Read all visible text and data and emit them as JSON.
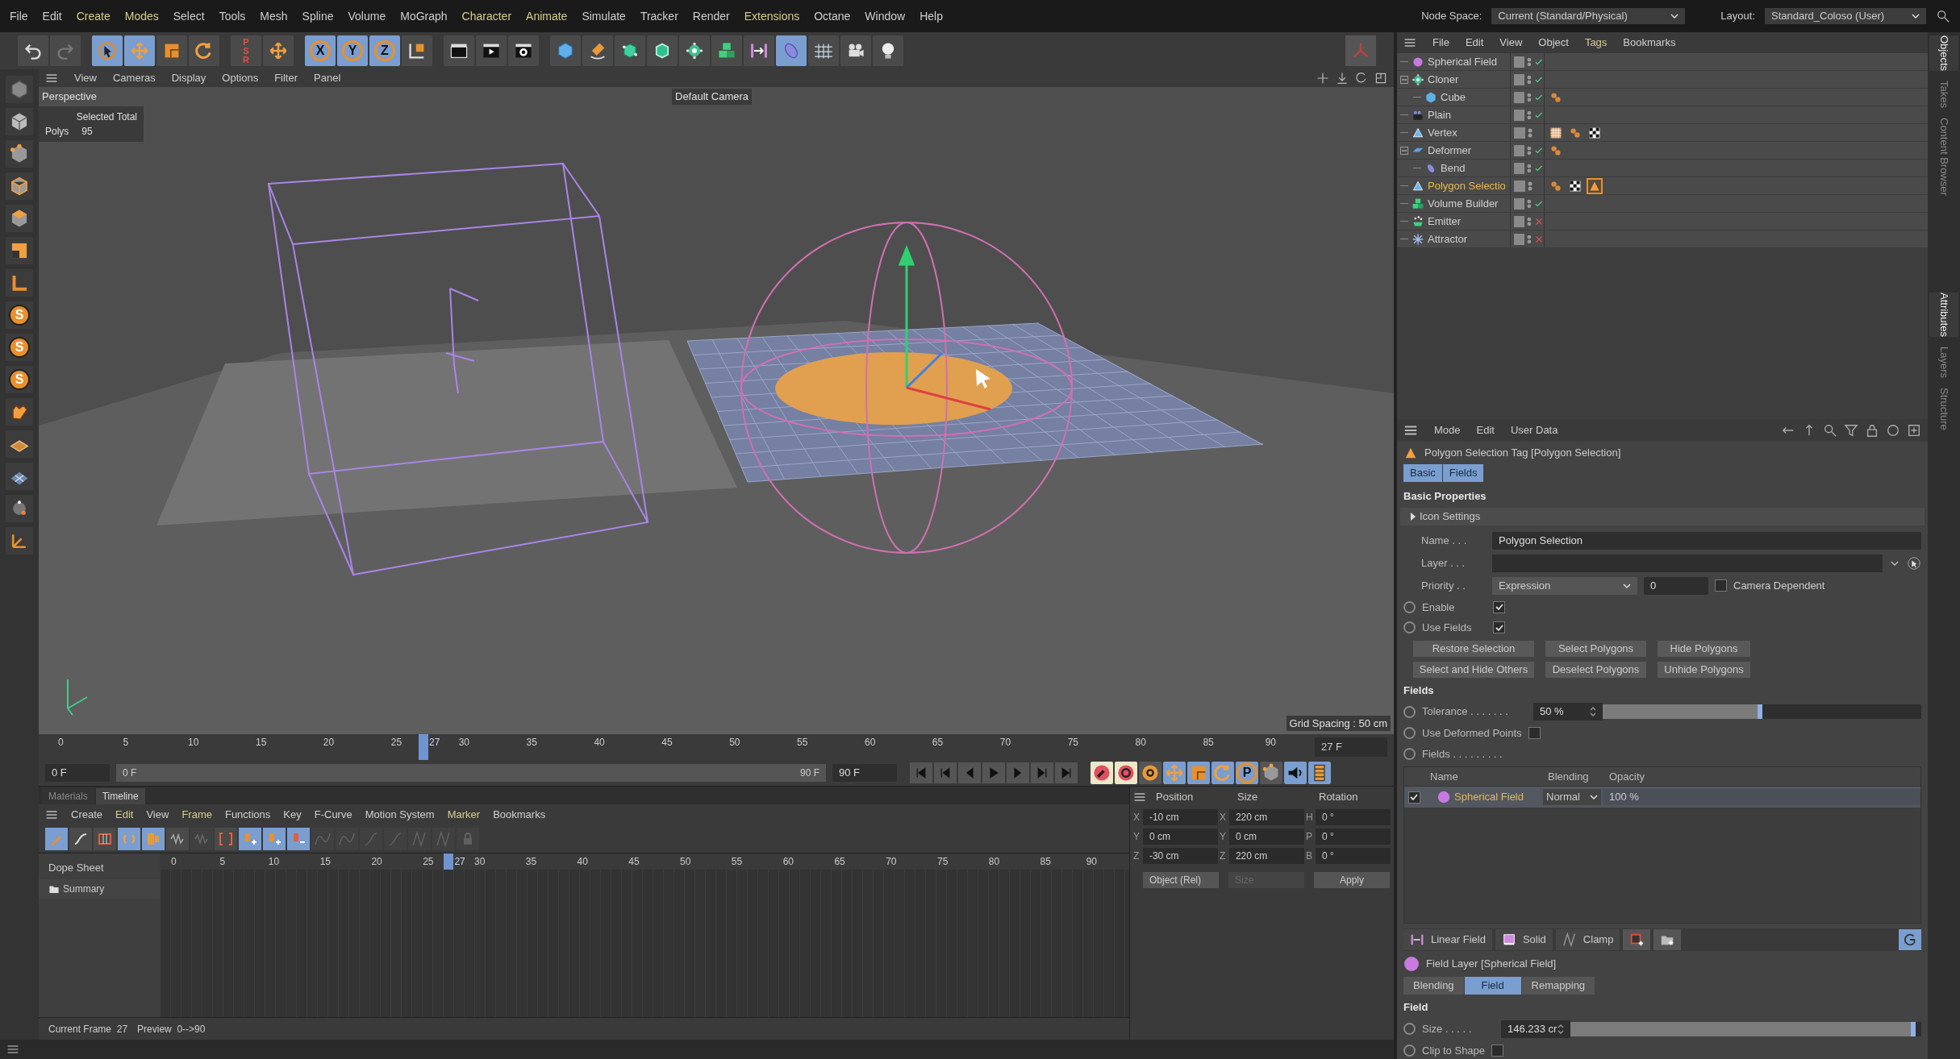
{
  "menu": [
    {
      "label": "File",
      "highlighted": false
    },
    {
      "label": "Edit",
      "highlighted": false
    },
    {
      "label": "Create",
      "highlighted": true
    },
    {
      "label": "Modes",
      "highlighted": true
    },
    {
      "label": "Select",
      "highlighted": false
    },
    {
      "label": "Tools",
      "highlighted": false
    },
    {
      "label": "Mesh",
      "highlighted": false
    },
    {
      "label": "Spline",
      "highlighted": false
    },
    {
      "label": "Volume",
      "highlighted": false
    },
    {
      "label": "MoGraph",
      "highlighted": false
    },
    {
      "label": "Character",
      "highlighted": true
    },
    {
      "label": "Animate",
      "highlighted": true
    },
    {
      "label": "Simulate",
      "highlighted": false
    },
    {
      "label": "Tracker",
      "highlighted": false
    },
    {
      "label": "Render",
      "highlighted": false
    },
    {
      "label": "Extensions",
      "highlighted": true
    },
    {
      "label": "Octane",
      "highlighted": false
    },
    {
      "label": "Window",
      "highlighted": false
    },
    {
      "label": "Help",
      "highlighted": false
    }
  ],
  "node_space": {
    "label": "Node Space:",
    "value": "Current (Standard/Physical)"
  },
  "layout": {
    "label": "Layout:",
    "value": "Standard_Coloso (User)"
  },
  "toolbar": [
    {
      "kind": "undo",
      "on": false
    },
    {
      "kind": "redo",
      "on": false
    },
    {
      "kind": "select",
      "on": true
    },
    {
      "kind": "move",
      "on": true
    },
    {
      "kind": "scale",
      "on": false
    },
    {
      "kind": "rotate",
      "on": false
    },
    {
      "kind": "psr",
      "label": "PSR",
      "on": false
    },
    {
      "kind": "move",
      "on": false
    },
    {
      "kind": "letter",
      "label": "X",
      "on": true
    },
    {
      "kind": "letter",
      "label": "Y",
      "on": true
    },
    {
      "kind": "letter",
      "label": "Z",
      "on": true
    },
    {
      "kind": "coord",
      "on": false
    },
    {
      "kind": "clapper",
      "on": false
    },
    {
      "kind": "clapper-play",
      "on": false
    },
    {
      "kind": "clapper-gear",
      "on": false
    },
    {
      "kind": "cube",
      "on": false
    },
    {
      "kind": "pen",
      "on": false
    },
    {
      "kind": "subdiv",
      "on": false
    },
    {
      "kind": "extrude",
      "on": false
    },
    {
      "kind": "cloner",
      "on": false
    },
    {
      "kind": "volume",
      "on": false
    },
    {
      "kind": "field",
      "on": false
    },
    {
      "kind": "deformer",
      "on": true
    },
    {
      "kind": "floor",
      "on": false
    },
    {
      "kind": "camera",
      "on": false
    },
    {
      "kind": "light",
      "on": false
    }
  ],
  "left_tools": [
    {
      "kind": "model"
    },
    {
      "kind": "texture"
    },
    {
      "kind": "points"
    },
    {
      "kind": "edges"
    },
    {
      "kind": "polygons"
    },
    {
      "kind": "uv"
    },
    {
      "kind": "axis"
    },
    {
      "kind": "letter",
      "label": "S"
    },
    {
      "kind": "letter",
      "label": "S"
    },
    {
      "kind": "letter",
      "label": "S"
    },
    {
      "kind": "snap"
    },
    {
      "kind": "workplane"
    },
    {
      "kind": "grid"
    },
    {
      "kind": "sphere"
    },
    {
      "kind": "axes"
    }
  ],
  "viewport": {
    "menu": [
      "View",
      "Cameras",
      "Display",
      "Options",
      "Filter",
      "Panel"
    ],
    "view_name": "Perspective",
    "camera": "Default Camera",
    "stats_title": "Selected Total",
    "stats_label": "Polys",
    "stats_value": "95",
    "grid_spacing": "Grid Spacing : 50 cm"
  },
  "ruler": {
    "ticks": [
      "0",
      "5",
      "10",
      "15",
      "20",
      "25",
      "30",
      "35",
      "40",
      "45",
      "50",
      "55",
      "60",
      "65",
      "70",
      "75",
      "80",
      "85",
      "90"
    ],
    "playhead": {
      "label": "27",
      "level": 0.3
    },
    "frame_field": "27 F"
  },
  "transport": {
    "start_field": "0 F",
    "range_start": "0 F",
    "range_end": "90 F",
    "end_field": "90 F"
  },
  "key_buttons": [
    {
      "kind": "record",
      "on": false
    },
    {
      "kind": "autorecord",
      "on": false
    },
    {
      "kind": "keysel",
      "on": false
    },
    {
      "kind": "move",
      "on": true
    },
    {
      "kind": "scale",
      "on": true
    },
    {
      "kind": "rotate",
      "on": true
    },
    {
      "kind": "letter",
      "label": "P",
      "on": true
    },
    {
      "kind": "points",
      "on": false
    },
    {
      "kind": "sound",
      "on": true
    },
    {
      "kind": "film",
      "on": true
    }
  ],
  "bottom_tabs": [
    {
      "label": "Materials",
      "selected": false
    },
    {
      "label": "Timeline",
      "selected": true
    }
  ],
  "timeline_menu": [
    {
      "label": "Create",
      "highlighted": false
    },
    {
      "label": "Edit",
      "highlighted": true
    },
    {
      "label": "View",
      "highlighted": false
    },
    {
      "label": "Frame",
      "highlighted": true
    },
    {
      "label": "Functions",
      "highlighted": false
    },
    {
      "label": "Key",
      "highlighted": false
    },
    {
      "label": "F-Curve",
      "highlighted": false
    },
    {
      "label": "Motion System",
      "highlighted": false
    },
    {
      "label": "Marker",
      "highlighted": true
    },
    {
      "label": "Bookmarks",
      "highlighted": false
    }
  ],
  "timeline_tools": [
    {
      "kind": "key",
      "on": true,
      "disabled": false
    },
    {
      "kind": "fcurve",
      "on": false,
      "disabled": false
    },
    {
      "kind": "sheet",
      "on": false,
      "disabled": false
    },
    {
      "kind": "loop",
      "on": true,
      "disabled": false
    },
    {
      "kind": "autokey",
      "on": true,
      "disabled": false
    },
    {
      "kind": "wave",
      "on": false,
      "disabled": false
    },
    {
      "kind": "wave",
      "on": false,
      "disabled": true
    },
    {
      "kind": "bracket",
      "on": false,
      "disabled": false
    },
    {
      "kind": "addkey",
      "on": true,
      "disabled": false
    },
    {
      "kind": "addkey",
      "on": true,
      "disabled": false
    },
    {
      "kind": "delkey",
      "on": true,
      "disabled": false
    },
    {
      "kind": "ease",
      "on": false,
      "disabled": true
    },
    {
      "kind": "ease",
      "on": false,
      "disabled": true
    },
    {
      "kind": "curve",
      "on": false,
      "disabled": true
    },
    {
      "kind": "curve",
      "on": false,
      "disabled": true
    },
    {
      "kind": "clamp",
      "on": false,
      "disabled": true
    },
    {
      "kind": "clamp",
      "on": false,
      "disabled": true
    },
    {
      "kind": "lock",
      "on": false,
      "disabled": true
    }
  ],
  "dope_sheet": {
    "title": "Dope Sheet",
    "rows": [
      "Summary"
    ],
    "ticks": [
      "0",
      "5",
      "10",
      "15",
      "20",
      "25",
      "30",
      "35",
      "40",
      "45",
      "50",
      "55",
      "60",
      "65",
      "70",
      "75",
      "80",
      "85",
      "90"
    ],
    "playhead": {
      "label": "27",
      "level": 0.3
    }
  },
  "timeline_status": [
    {
      "label": "Current Frame",
      "value": "27"
    },
    {
      "label": "Preview",
      "value": "0-->90"
    }
  ],
  "coordinates": {
    "headers": [
      "Position",
      "Size",
      "Rotation"
    ],
    "rows": [
      [
        {
          "axis": "X",
          "value": "-10 cm"
        },
        {
          "axis": "X",
          "value": "220 cm"
        },
        {
          "axis": "H",
          "value": "0 °"
        }
      ],
      [
        {
          "axis": "Y",
          "value": "0 cm"
        },
        {
          "axis": "Y",
          "value": "0 cm"
        },
        {
          "axis": "P",
          "value": "0 °"
        }
      ],
      [
        {
          "axis": "Z",
          "value": "-30 cm"
        },
        {
          "axis": "Z",
          "value": "220 cm"
        },
        {
          "axis": "B",
          "value": "0 °"
        }
      ]
    ],
    "mode": "Object (Rel)",
    "size_mode": {
      "value": "Size",
      "disabled": true
    },
    "apply": "Apply"
  },
  "objects": {
    "menu": [
      {
        "label": "File",
        "highlighted": false
      },
      {
        "label": "Edit",
        "highlighted": false
      },
      {
        "label": "View",
        "highlighted": false
      },
      {
        "label": "Object",
        "highlighted": false
      },
      {
        "label": "Tags",
        "highlighted": true
      },
      {
        "label": "Bookmarks",
        "highlighted": false
      }
    ],
    "items": [
      {
        "name": "Spherical Field",
        "kind": "sphere-field",
        "enabled": true,
        "selected": false
      },
      {
        "name": "Cloner",
        "kind": "cloner",
        "enabled": true,
        "selected": false,
        "expanded": true,
        "children": [
          {
            "name": "Cube",
            "kind": "cube",
            "enabled": true,
            "selected": false,
            "tags": [
              {
                "kind": "phong",
                "selected": false
              }
            ]
          }
        ]
      },
      {
        "name": "Plain",
        "kind": "plain",
        "enabled": true,
        "selected": false
      },
      {
        "name": "Vertex",
        "kind": "vertex",
        "selected": false,
        "tags": [
          {
            "kind": "vertexmap",
            "selected": false
          },
          {
            "kind": "phong",
            "selected": false
          },
          {
            "kind": "checker",
            "selected": false
          }
        ]
      },
      {
        "name": "Deformer",
        "kind": "deformer",
        "enabled": true,
        "selected": false,
        "expanded": true,
        "tags": [
          {
            "kind": "phong",
            "selected": false
          }
        ],
        "children": [
          {
            "name": "Bend",
            "kind": "bend",
            "enabled": true,
            "selected": false
          }
        ]
      },
      {
        "name": "Polygon Selectio",
        "kind": "vertex",
        "selected": true,
        "tags": [
          {
            "kind": "phong",
            "selected": false
          },
          {
            "kind": "checker",
            "selected": false
          },
          {
            "kind": "polyselection",
            "selected": true
          }
        ]
      },
      {
        "name": "Volume Builder",
        "kind": "volume",
        "enabled": true,
        "selected": false
      },
      {
        "name": "Emitter",
        "kind": "emitter",
        "enabled": false,
        "selected": false
      },
      {
        "name": "Attractor",
        "kind": "attractor",
        "enabled": false,
        "selected": false
      }
    ]
  },
  "side_tabs_top": [
    {
      "label": "Objects",
      "selected": true
    },
    {
      "label": "Takes",
      "selected": false
    },
    {
      "label": "Content Browser",
      "selected": false
    }
  ],
  "side_tabs_bottom": [
    {
      "label": "Attributes",
      "selected": true
    },
    {
      "label": "Layers",
      "selected": false
    },
    {
      "label": "Structure",
      "selected": false
    }
  ],
  "attributes": {
    "menu": [
      "Mode",
      "Edit",
      "User Data"
    ],
    "title": "Polygon Selection Tag [Polygon Selection]",
    "tabs": [
      {
        "label": "Basic",
        "selected": true
      },
      {
        "label": "Fields",
        "selected": true
      }
    ],
    "section": "Basic Properties",
    "group": {
      "label": "Icon Settings",
      "expanded": false
    },
    "name": {
      "label": "Name . . .",
      "value": "Polygon Selection"
    },
    "layer": {
      "label": "Layer . . ."
    },
    "priority": {
      "label": "Priority . .",
      "value": "Expression",
      "number": "0",
      "camera_dependent": {
        "label": "Camera Dependent",
        "checked": false
      }
    },
    "flags": [
      {
        "label": "Enable",
        "checked": true
      },
      {
        "label": "Use Fields",
        "checked": true
      }
    ],
    "buttons": [
      "Restore Selection",
      "Select Polygons",
      "Hide Polygons",
      "Select and Hide Others",
      "Deselect Polygons",
      "Unhide Polygons"
    ],
    "fields_section": "Fields",
    "tolerance": {
      "label": "Tolerance . . . . . . .",
      "value": "50 %",
      "level": 0.5
    },
    "deformed": {
      "label": "Use Deformed Points",
      "checked": false
    },
    "fields_label": "Fields . . . . . . . . .",
    "table": {
      "columns": [
        "Name",
        "Blending",
        "Opacity"
      ],
      "rows": [
        {
          "checked": true,
          "name": "Spherical Field",
          "blending": "Normal",
          "opacity": "100 %"
        }
      ]
    },
    "field_tools": [
      {
        "kind": "linear",
        "label": "Linear Field"
      },
      {
        "kind": "solid",
        "label": "Solid"
      },
      {
        "kind": "clamp",
        "label": "Clamp"
      },
      {
        "kind": "add-layer"
      },
      {
        "kind": "add-folder"
      }
    ],
    "layer_title": "Field Layer [Spherical Field]",
    "layer_tabs": [
      {
        "label": "Blending",
        "selected": false
      },
      {
        "label": "Field",
        "selected": true
      },
      {
        "label": "Remapping",
        "selected": false
      }
    ],
    "field_section": "Field",
    "size": {
      "label": "Size . . . . .",
      "value": "146.233 cr",
      "level": 0.985
    },
    "clip": {
      "label": "Clip to Shape",
      "checked": false
    }
  }
}
